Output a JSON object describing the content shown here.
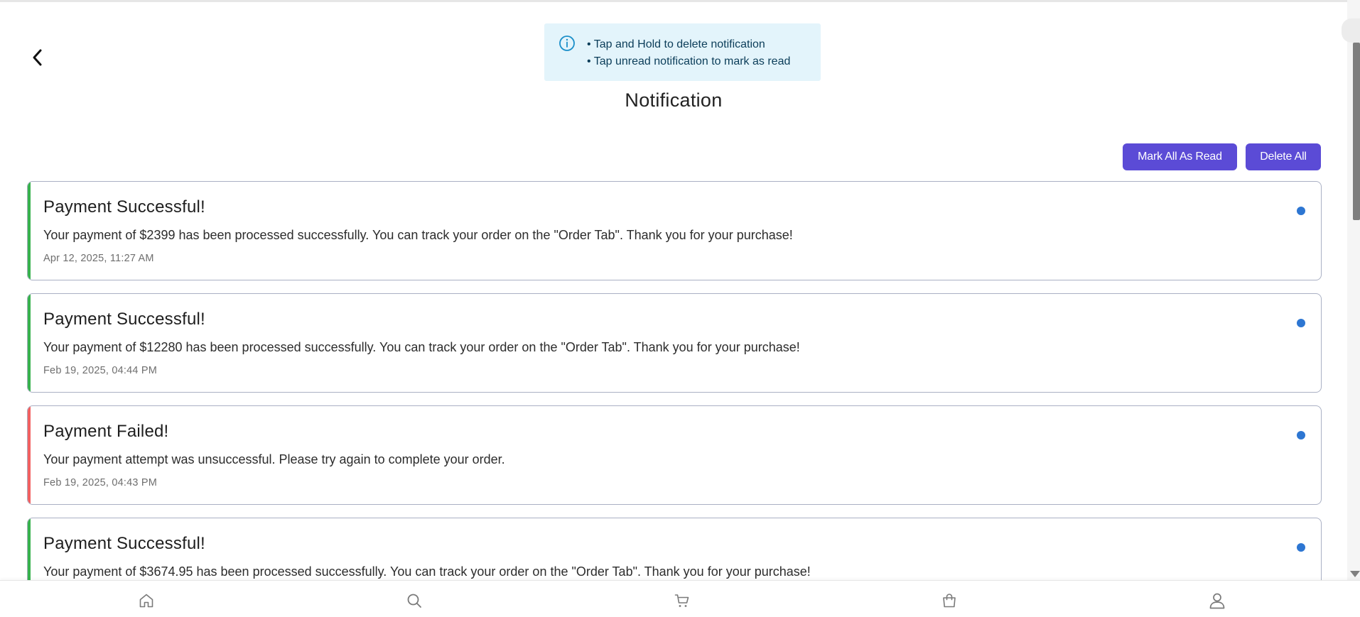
{
  "info": {
    "lines": [
      "• Tap and Hold to delete notification",
      "• Tap unread notification to mark as read"
    ]
  },
  "page": {
    "title": "Notification"
  },
  "actions": {
    "mark_all_read": "Mark All As Read",
    "delete_all": "Delete All"
  },
  "notifications": [
    {
      "status": "success",
      "title": "Payment Successful!",
      "body": "Your payment of $2399 has been processed successfully. You can track your order on the \"Order Tab\". Thank you for your purchase!",
      "time": "Apr 12, 2025, 11:27 AM",
      "unread": true
    },
    {
      "status": "success",
      "title": "Payment Successful!",
      "body": "Your payment of $12280 has been processed successfully. You can track your order on the \"Order Tab\". Thank you for your purchase!",
      "time": "Feb 19, 2025, 04:44 PM",
      "unread": true
    },
    {
      "status": "failed",
      "title": "Payment Failed!",
      "body": "Your payment attempt was unsuccessful. Please try again to complete your order.",
      "time": "Feb 19, 2025, 04:43 PM",
      "unread": true
    },
    {
      "status": "success",
      "title": "Payment Successful!",
      "body": "Your payment of $3674.95 has been processed successfully. You can track your order on the \"Order Tab\". Thank you for your purchase!",
      "time": "",
      "unread": true
    }
  ],
  "colors": {
    "accent": "#5b4bd6",
    "success": "#37b24d",
    "failed": "#f26060",
    "unread_dot": "#2d76d2",
    "info_bg": "#e3f4fb"
  },
  "bottom_nav": {
    "items": [
      {
        "icon": "home-icon"
      },
      {
        "icon": "search-icon"
      },
      {
        "icon": "cart-icon"
      },
      {
        "icon": "shopping-bag-icon"
      },
      {
        "icon": "user-icon"
      }
    ]
  }
}
